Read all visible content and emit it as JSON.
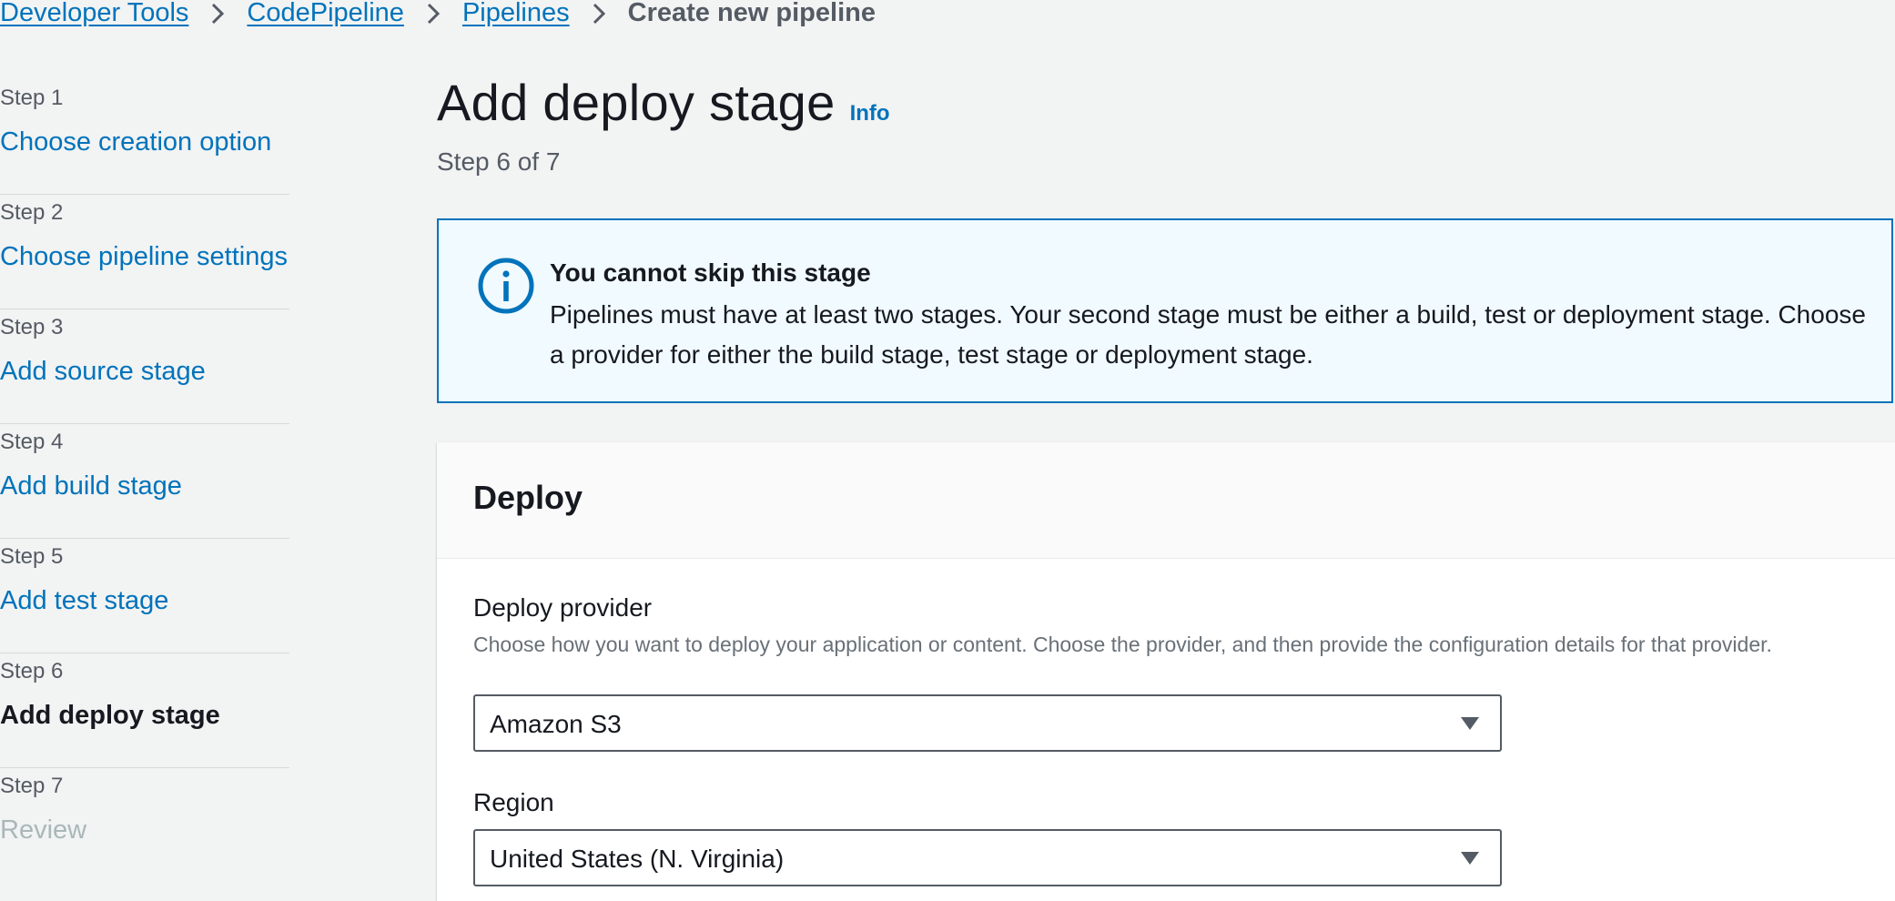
{
  "breadcrumb": {
    "items": [
      "Developer Tools",
      "CodePipeline",
      "Pipelines"
    ],
    "current": "Create new pipeline"
  },
  "wizard": {
    "steps": [
      {
        "num": "Step 1",
        "label": "Choose creation option",
        "state": "link"
      },
      {
        "num": "Step 2",
        "label": "Choose pipeline settings",
        "state": "link"
      },
      {
        "num": "Step 3",
        "label": "Add source stage",
        "state": "link"
      },
      {
        "num": "Step 4",
        "label": "Add build stage",
        "state": "link"
      },
      {
        "num": "Step 5",
        "label": "Add test stage",
        "state": "link"
      },
      {
        "num": "Step 6",
        "label": "Add deploy stage",
        "state": "active"
      },
      {
        "num": "Step 7",
        "label": "Review",
        "state": "disabled"
      }
    ]
  },
  "page": {
    "title": "Add deploy stage",
    "info": "Info",
    "step_counter": "Step 6 of 7"
  },
  "alert": {
    "title": "You cannot skip this stage",
    "body": "Pipelines must have at least two stages. Your second stage must be either a build, test or deployment stage. Choose a provider for either the build stage, test stage or deployment stage."
  },
  "deploy": {
    "heading": "Deploy",
    "provider_label": "Deploy provider",
    "provider_desc": "Choose how you want to deploy your application or content. Choose the provider, and then provide the configuration details for that provider.",
    "provider_value": "Amazon S3",
    "region_label": "Region",
    "region_value": "United States (N. Virginia)"
  },
  "colors": {
    "link": "#0073bb",
    "text": "#16191f",
    "muted": "#545b64",
    "alert_bg": "#f1faff",
    "page_bg": "#f2f3f3"
  }
}
